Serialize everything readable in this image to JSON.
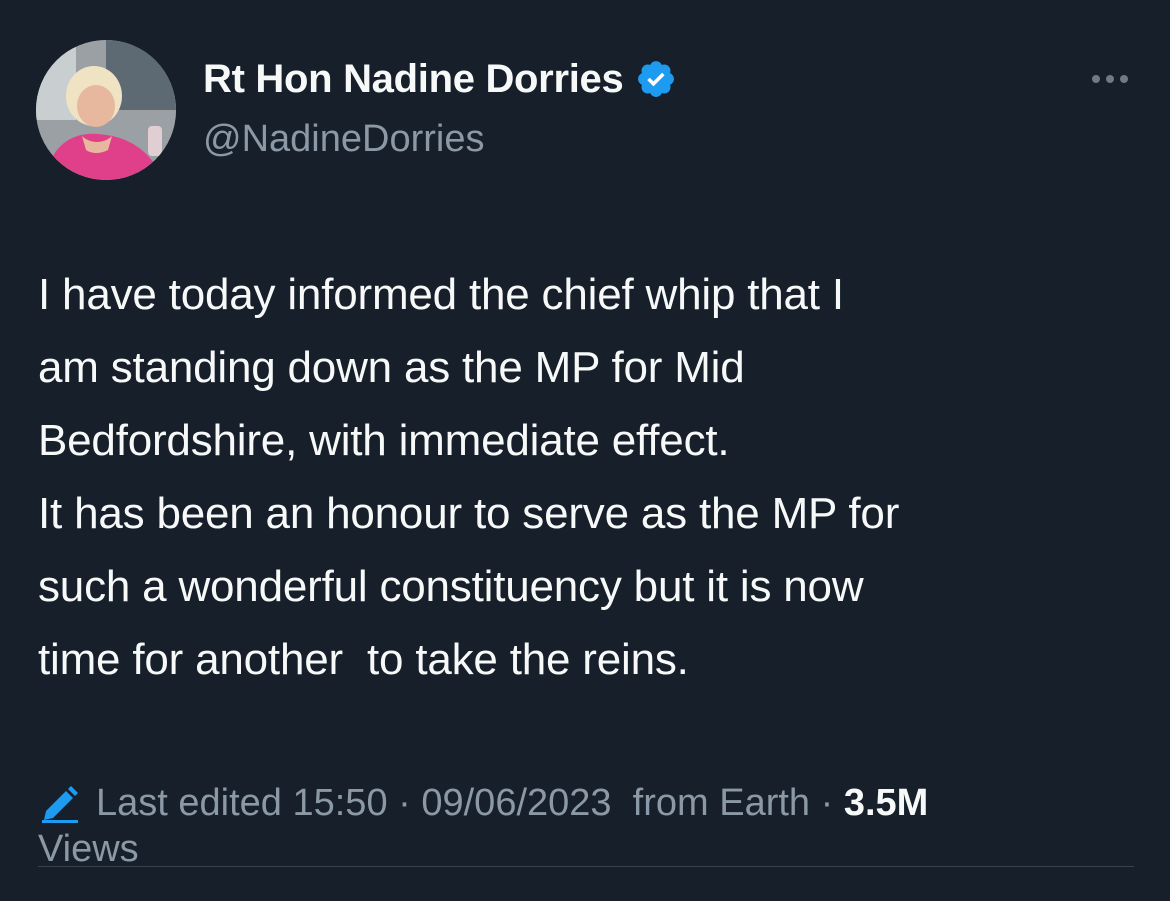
{
  "author": {
    "display_name": "Rt Hon Nadine Dorries",
    "handle": "@NadineDorries",
    "verified": true
  },
  "tweet": {
    "lines": [
      "I have today informed the chief whip that I",
      "am standing down as the MP for Mid",
      "Bedfordshire, with immediate effect.",
      "It has been an honour to serve as the MP for",
      "such a wonderful constituency but it is now",
      "time for another  to take the reins."
    ]
  },
  "meta": {
    "edited_label": "Last edited",
    "time": "15:50",
    "separator": " · ",
    "date": "09/06/2023",
    "source": "  from Earth",
    "views_count": "3.5M",
    "views_label": "Views"
  },
  "icons": {
    "verified": "verified-badge-icon",
    "edit": "pencil-edit-icon",
    "more": "more-options-icon"
  },
  "colors": {
    "background": "#15202b",
    "accent": "#1d9bf0",
    "text_primary": "#f7f9f9",
    "text_secondary": "#8b98a5"
  }
}
